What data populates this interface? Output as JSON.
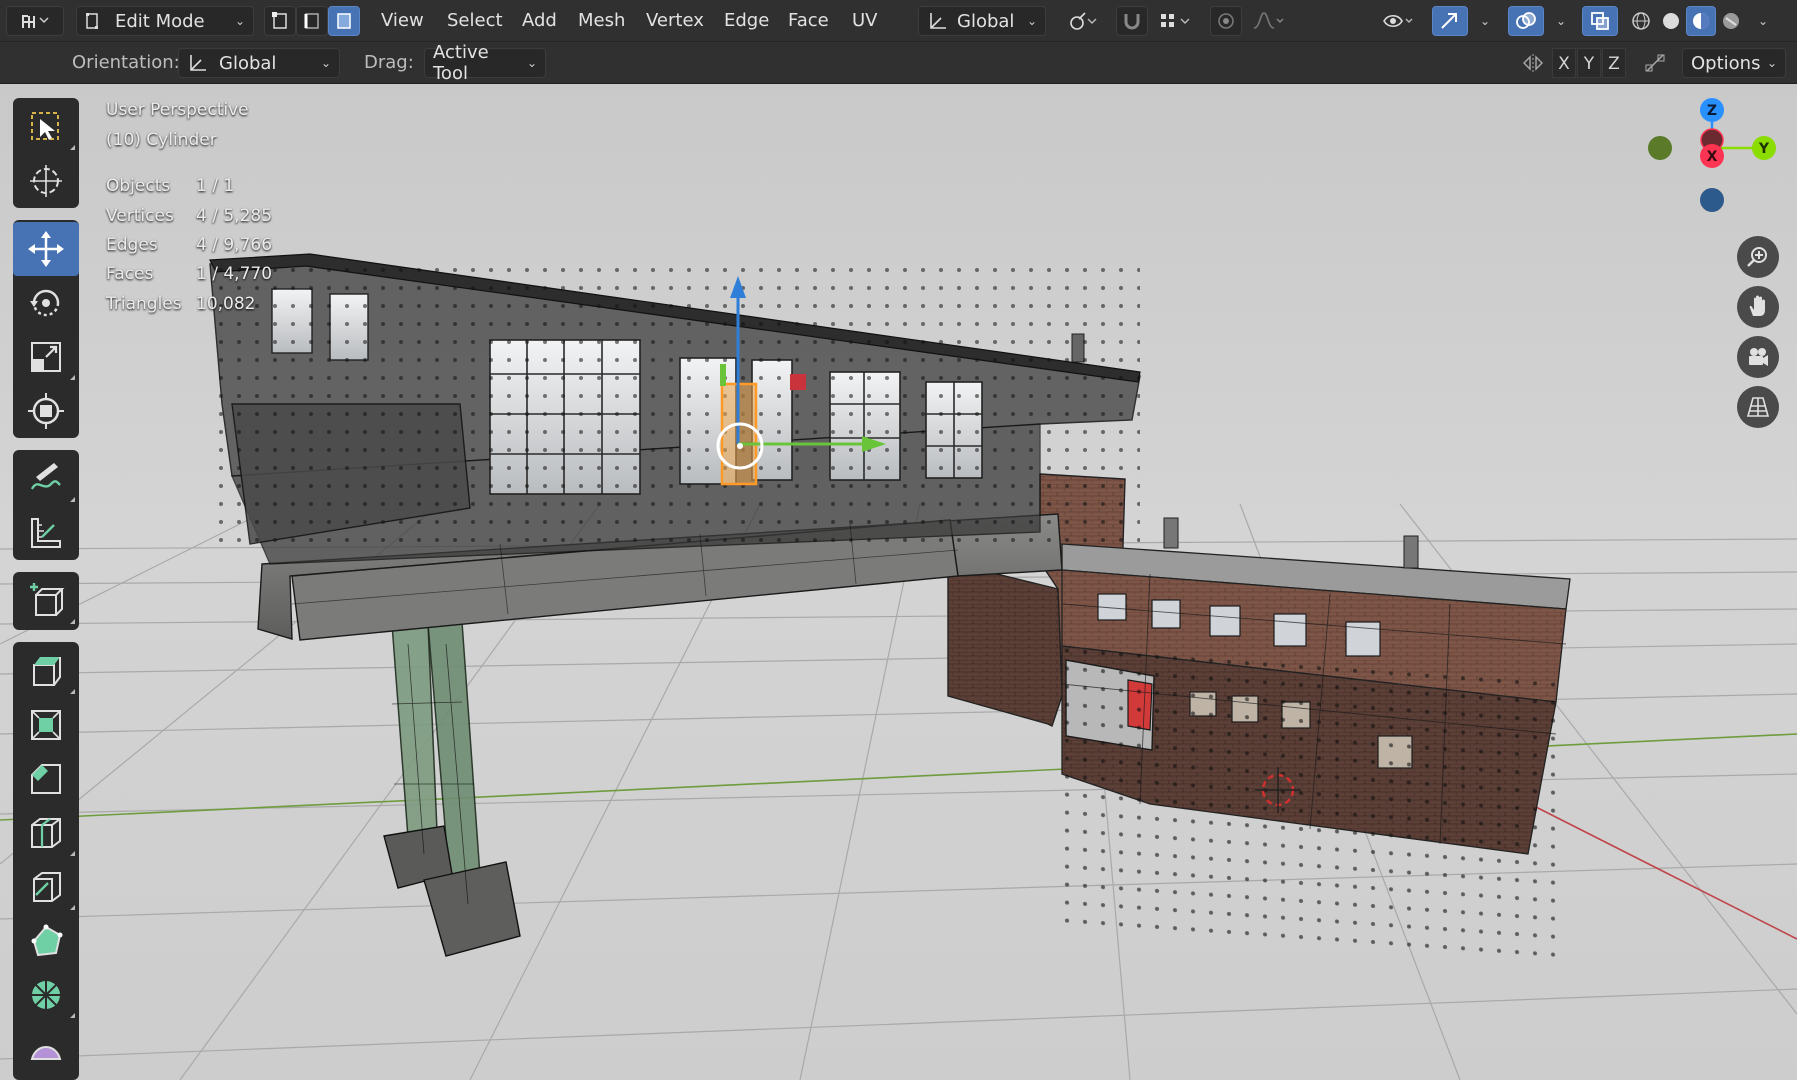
{
  "header": {
    "editor_type_icon": "cursor-grid-icon",
    "mode_dropdown": "Edit Mode",
    "select_modes": [
      "vertex-select-icon",
      "edge-select-icon",
      "face-select-icon"
    ],
    "menus": [
      "View",
      "Select",
      "Add",
      "Mesh",
      "Vertex",
      "Edge",
      "Face",
      "UV"
    ],
    "transform_orientation": "Global",
    "pivot_icon": "pivot-point-icon",
    "snap_icon": "magnet-icon",
    "snap_target_icon": "snap-increment-icon",
    "proportional_icon": "proportional-editing-icon",
    "falloff_icon": "falloff-curve-icon",
    "visibility_icon": "eye-icon",
    "gizmo_icon": "gizmo-arrow-icon",
    "overlay_icon": "overlay-circles-icon",
    "xray_icon": "xray-icon",
    "shading_modes": [
      "wireframe-shading-icon",
      "solid-shading-icon",
      "material-shading-icon",
      "rendered-shading-icon"
    ]
  },
  "subheader": {
    "orientation_label": "Orientation:",
    "orientation_value": "Global",
    "drag_label": "Drag:",
    "drag_value": "Active Tool",
    "axes": [
      "X",
      "Y",
      "Z"
    ],
    "options_label": "Options"
  },
  "viewport_info": {
    "perspective": "User Perspective",
    "object": "(10) Cylinder",
    "stats": [
      {
        "label": "Objects",
        "value": "1 / 1"
      },
      {
        "label": "Vertices",
        "value": "4 / 5,285"
      },
      {
        "label": "Edges",
        "value": "4 / 9,766"
      },
      {
        "label": "Faces",
        "value": "1 / 4,770"
      },
      {
        "label": "Triangles",
        "value": "10,082"
      }
    ]
  },
  "navigation_gizmo": {
    "axes": [
      "Z",
      "X",
      "Y"
    ],
    "colors": {
      "x": "#ff3352",
      "y": "#8bdc00",
      "z": "#2890ff"
    }
  },
  "nav_buttons": [
    "zoom-icon",
    "hand-pan-icon",
    "camera-icon",
    "perspective-grid-icon"
  ],
  "toolbar": {
    "groups": [
      [
        "select-box-icon",
        "cursor-icon"
      ],
      [
        "move-icon",
        "rotate-icon",
        "scale-icon",
        "transform-icon"
      ],
      [
        "annotate-icon",
        "measure-icon"
      ],
      [
        "add-cube-icon"
      ],
      [
        "extrude-icon",
        "inset-icon",
        "bevel-icon",
        "loop-cut-icon",
        "knife-icon",
        "poly-build-icon",
        "spin-icon",
        "smooth-icon"
      ]
    ],
    "active_tool": "move-icon"
  }
}
